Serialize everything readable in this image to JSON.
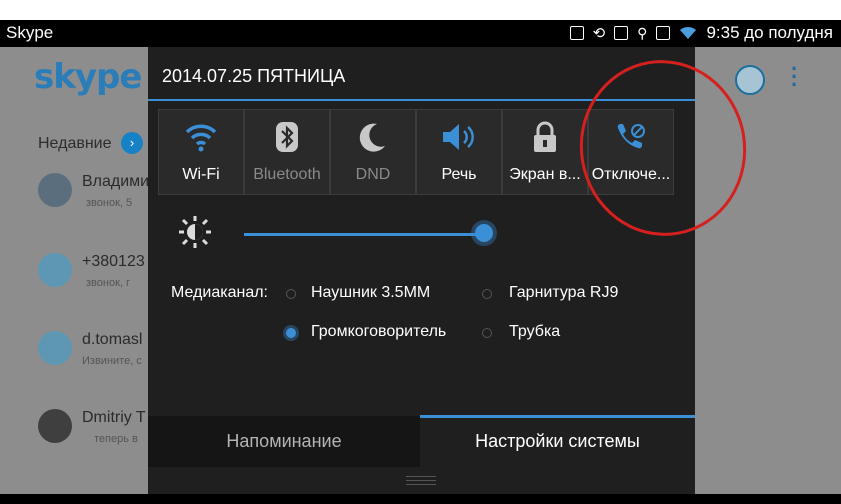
{
  "status_bar": {
    "app_name": "Skype",
    "time": "9:35 до полудня"
  },
  "background_app": {
    "logo_text": "skype",
    "recent_label": "Недавние",
    "contacts": [
      {
        "name": "Владими",
        "sub": "звонок, 5"
      },
      {
        "name": "+380123",
        "sub": "звонок, г"
      },
      {
        "name": "d.tomasl",
        "sub": "Извините, с"
      },
      {
        "name": "Dmitriy T",
        "sub": "теперь в"
      }
    ]
  },
  "panel": {
    "date": "2014.07.25 ПЯТНИЦА",
    "tiles": [
      {
        "label": "Wi-Fi",
        "icon": "wifi-icon",
        "state": "on"
      },
      {
        "label": "Bluetooth",
        "icon": "bluetooth-icon",
        "state": "off"
      },
      {
        "label": "DND",
        "icon": "moon-icon",
        "state": "off"
      },
      {
        "label": "Речь",
        "icon": "speaker-icon",
        "state": "on"
      },
      {
        "label": "Экран в...",
        "icon": "lock-icon",
        "state": "on"
      },
      {
        "label": "Отключе...",
        "icon": "call-mute-icon",
        "state": "on"
      }
    ],
    "brightness_level": 1.0,
    "media": {
      "label": "Медиаканал:",
      "options": [
        {
          "label": "Наушник 3.5MM",
          "selected": false
        },
        {
          "label": "Гарнитура RJ9",
          "selected": false
        },
        {
          "label": "Громкоговоритель",
          "selected": true
        },
        {
          "label": "Трубка",
          "selected": false
        }
      ]
    },
    "tabs": {
      "reminder": "Напоминание",
      "settings": "Настройки системы"
    }
  },
  "colors": {
    "accent": "#3a8fd6",
    "annotation": "#d5201e",
    "skype_blue": "#1681c4"
  }
}
